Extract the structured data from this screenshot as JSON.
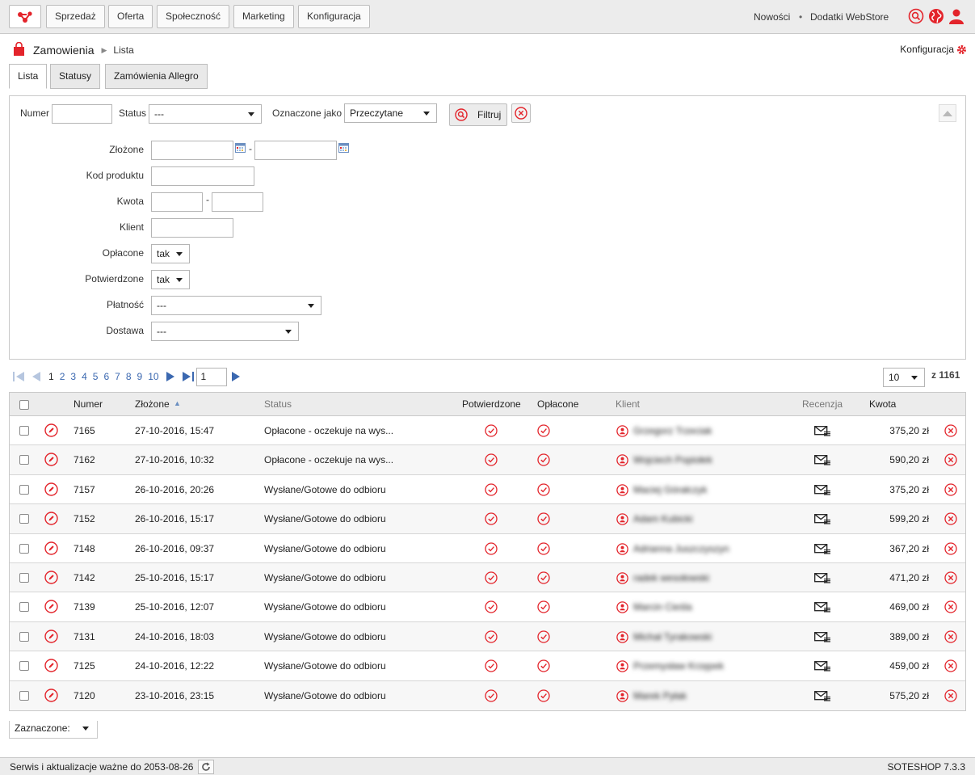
{
  "colors": {
    "accent": "#e3242b",
    "link": "#3b68b0",
    "bar": "#ececec",
    "border": "#c9c9c9"
  },
  "topnav": {
    "logo_icon": "soteshop-logo-icon",
    "items": [
      "Sprzedaż",
      "Oferta",
      "Społeczność",
      "Marketing",
      "Konfiguracja"
    ],
    "news": "Nowości",
    "separator": "•",
    "addons": "Dodatki WebStore",
    "icons": [
      "search-icon",
      "globe-icon",
      "user-icon"
    ]
  },
  "breadcrumb": {
    "icon": "shopping-bag-icon",
    "title": "Zamowienia",
    "arrow": "▶",
    "current": "Lista"
  },
  "config_link": {
    "label": "Konfiguracja",
    "icon": "gear-icon"
  },
  "tabs": [
    "Lista",
    "Statusy",
    "Zamówienia Allegro"
  ],
  "filters": {
    "numer_label": "Numer",
    "numer_value": "",
    "status_label": "Status",
    "status_value": "---",
    "marked_label": "Oznaczone jako",
    "marked_value": "Przeczytane",
    "filter_button": "Filtruj",
    "zlozone_label": "Złożone",
    "date_separator": "-",
    "kod_label": "Kod produktu",
    "kwota_label": "Kwota",
    "klient_label": "Klient",
    "oplacone_label": "Opłacone",
    "oplacone_value": "tak",
    "potwierdzone_label": "Potwierdzone",
    "potwierdzone_value": "tak",
    "platnosc_label": "Płatność",
    "platnosc_value": "---",
    "dostawa_label": "Dostawa",
    "dostawa_value": "---"
  },
  "pager": {
    "pages": [
      "1",
      "2",
      "3",
      "4",
      "5",
      "6",
      "7",
      "8",
      "9",
      "10"
    ],
    "current_page": "1",
    "page_input": "1",
    "per_page": "10",
    "total": "z 1161"
  },
  "table": {
    "headers": {
      "numer": "Numer",
      "zlozone": "Złożone",
      "sort_arrow": "▲",
      "status": "Status",
      "potwierdzone": "Potwierdzone",
      "oplacone": "Opłacone",
      "klient": "Klient",
      "recenzja": "Recenzja",
      "kwota": "Kwota"
    },
    "rows": [
      {
        "numer": "7165",
        "date": "27-10-2016, 15:47",
        "status": "Opłacone - oczekuje na wys...",
        "client": "Grzegorz Trzeciak",
        "amount": "375,20 zł"
      },
      {
        "numer": "7162",
        "date": "27-10-2016, 10:32",
        "status": "Opłacone - oczekuje na wys...",
        "client": "Wojciech Popiołek",
        "amount": "590,20 zł"
      },
      {
        "numer": "7157",
        "date": "26-10-2016, 20:26",
        "status": "Wysłane/Gotowe do odbioru",
        "client": "Maciej Górałczyk",
        "amount": "375,20 zł"
      },
      {
        "numer": "7152",
        "date": "26-10-2016, 15:17",
        "status": "Wysłane/Gotowe do odbioru",
        "client": "Adam Kubicki",
        "amount": "599,20 zł"
      },
      {
        "numer": "7148",
        "date": "26-10-2016, 09:37",
        "status": "Wysłane/Gotowe do odbioru",
        "client": "Adrianna Juszczyszyn",
        "amount": "367,20 zł"
      },
      {
        "numer": "7142",
        "date": "25-10-2016, 15:17",
        "status": "Wysłane/Gotowe do odbioru",
        "client": "radek wesołowski",
        "amount": "471,20 zł"
      },
      {
        "numer": "7139",
        "date": "25-10-2016, 12:07",
        "status": "Wysłane/Gotowe do odbioru",
        "client": "Marcin Cieśla",
        "amount": "469,00 zł"
      },
      {
        "numer": "7131",
        "date": "24-10-2016, 18:03",
        "status": "Wysłane/Gotowe do odbioru",
        "client": "Michał Tyrakowski",
        "amount": "389,00 zł"
      },
      {
        "numer": "7125",
        "date": "24-10-2016, 12:22",
        "status": "Wysłane/Gotowe do odbioru",
        "client": "Przemysław Krzępek",
        "amount": "459,00 zł"
      },
      {
        "numer": "7120",
        "date": "23-10-2016, 23:15",
        "status": "Wysłane/Gotowe do odbioru",
        "client": "Marek Pyłak",
        "amount": "575,20 zł"
      }
    ]
  },
  "bulk": {
    "label": "Zaznaczone:"
  },
  "footer": {
    "service": "Serwis i aktualizacje ważne do 2053-08-26",
    "version": "SOTESHOP 7.3.3"
  }
}
